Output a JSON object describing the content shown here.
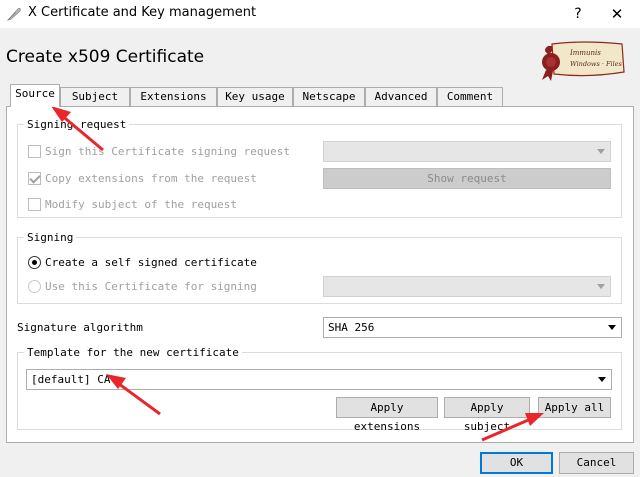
{
  "window": {
    "title": "X Certificate and Key management",
    "help": "?",
    "close": "✕"
  },
  "dialog": {
    "heading": "Create x509 Certificate",
    "logo_text_1": "Immunis",
    "logo_text_2": "Windows · Files"
  },
  "tabs": [
    {
      "label": "Source",
      "active": true
    },
    {
      "label": "Subject"
    },
    {
      "label": "Extensions"
    },
    {
      "label": "Key usage"
    },
    {
      "label": "Netscape"
    },
    {
      "label": "Advanced"
    },
    {
      "label": "Comment"
    }
  ],
  "signing_request": {
    "legend": "Signing request",
    "sign_label": "Sign this Certificate signing request",
    "copy_label": "Copy extensions from the request",
    "modify_label": "Modify subject of the request",
    "show_request": "Show request"
  },
  "signing": {
    "legend": "Signing",
    "self_signed": "Create a self signed certificate",
    "use_cert": "Use this Certificate for signing"
  },
  "signature": {
    "label": "Signature algorithm",
    "value": "SHA 256"
  },
  "template": {
    "legend": "Template for the new certificate",
    "value": "[default] CA",
    "apply_extensions": "Apply extensions",
    "apply_subject": "Apply subject",
    "apply_all": "Apply all"
  },
  "footer": {
    "ok": "OK",
    "cancel": "Cancel"
  },
  "colors": {
    "annotation_arrow": "#e8262b",
    "default_button_border": "#0078d7"
  }
}
